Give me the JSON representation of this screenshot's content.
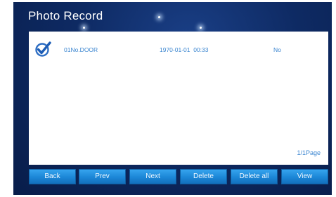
{
  "header": {
    "title": "Photo Record"
  },
  "records": [
    {
      "checked": true,
      "name": "01No.DOOR",
      "datetime": "1970-01-01  00:33",
      "status": "No"
    }
  ],
  "pagination": {
    "indicator": "1/1Page"
  },
  "buttons": {
    "back": "Back",
    "prev": "Prev",
    "next": "Next",
    "delete": "Delete",
    "delete_all": "Delete all",
    "view": "View"
  },
  "icons": {
    "record_check": "check-circle-icon"
  },
  "colors": {
    "background": "#0e2a63",
    "panel": "#ffffff",
    "text_accent": "#3a85d0",
    "button": "#1b86d6"
  }
}
